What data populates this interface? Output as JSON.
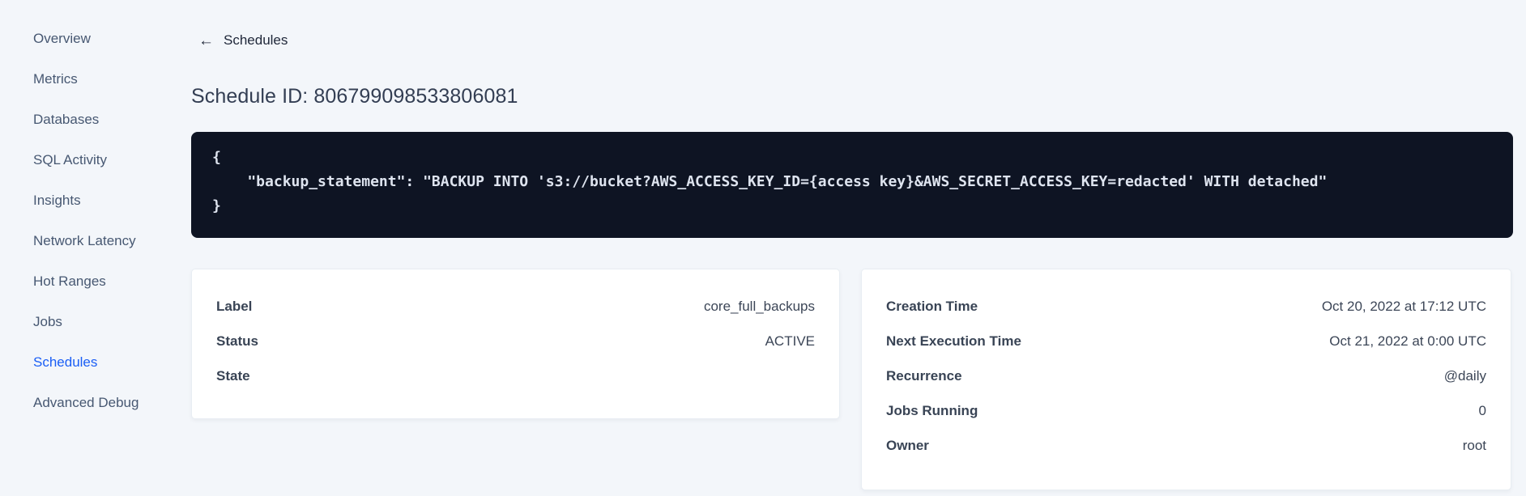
{
  "sidebar": {
    "items": [
      {
        "label": "Overview"
      },
      {
        "label": "Metrics"
      },
      {
        "label": "Databases"
      },
      {
        "label": "SQL Activity"
      },
      {
        "label": "Insights"
      },
      {
        "label": "Network Latency"
      },
      {
        "label": "Hot Ranges"
      },
      {
        "label": "Jobs"
      },
      {
        "label": "Schedules"
      },
      {
        "label": "Advanced Debug"
      }
    ],
    "active_item": "Schedules"
  },
  "header": {
    "back_icon": "←",
    "back_label": "Schedules",
    "page_title": "Schedule ID: 806799098533806081"
  },
  "code_block": {
    "content": "{\n    \"backup_statement\": \"BACKUP INTO 's3://bucket?AWS_ACCESS_KEY_ID={access key}&AWS_SECRET_ACCESS_KEY=redacted' WITH detached\"\n}"
  },
  "details_card": {
    "rows": [
      {
        "label": "Label",
        "value": "core_full_backups"
      },
      {
        "label": "Status",
        "value": "ACTIVE"
      },
      {
        "label": "State",
        "value": ""
      }
    ]
  },
  "schedule_card": {
    "rows": [
      {
        "label": "Creation Time",
        "value": "Oct 20, 2022 at 17:12 UTC"
      },
      {
        "label": "Next Execution Time",
        "value": "Oct 21, 2022 at 0:00 UTC"
      },
      {
        "label": "Recurrence",
        "value": "@daily"
      },
      {
        "label": "Jobs Running",
        "value": "0"
      },
      {
        "label": "Owner",
        "value": "root"
      }
    ]
  },
  "colors": {
    "page_background": "#f3f6fa",
    "active_link_blue": "#1a5ef5",
    "code_background": "#0e1423",
    "code_text": "#dee4ef",
    "text_dark": "#394455",
    "card_background": "#ffffff"
  }
}
